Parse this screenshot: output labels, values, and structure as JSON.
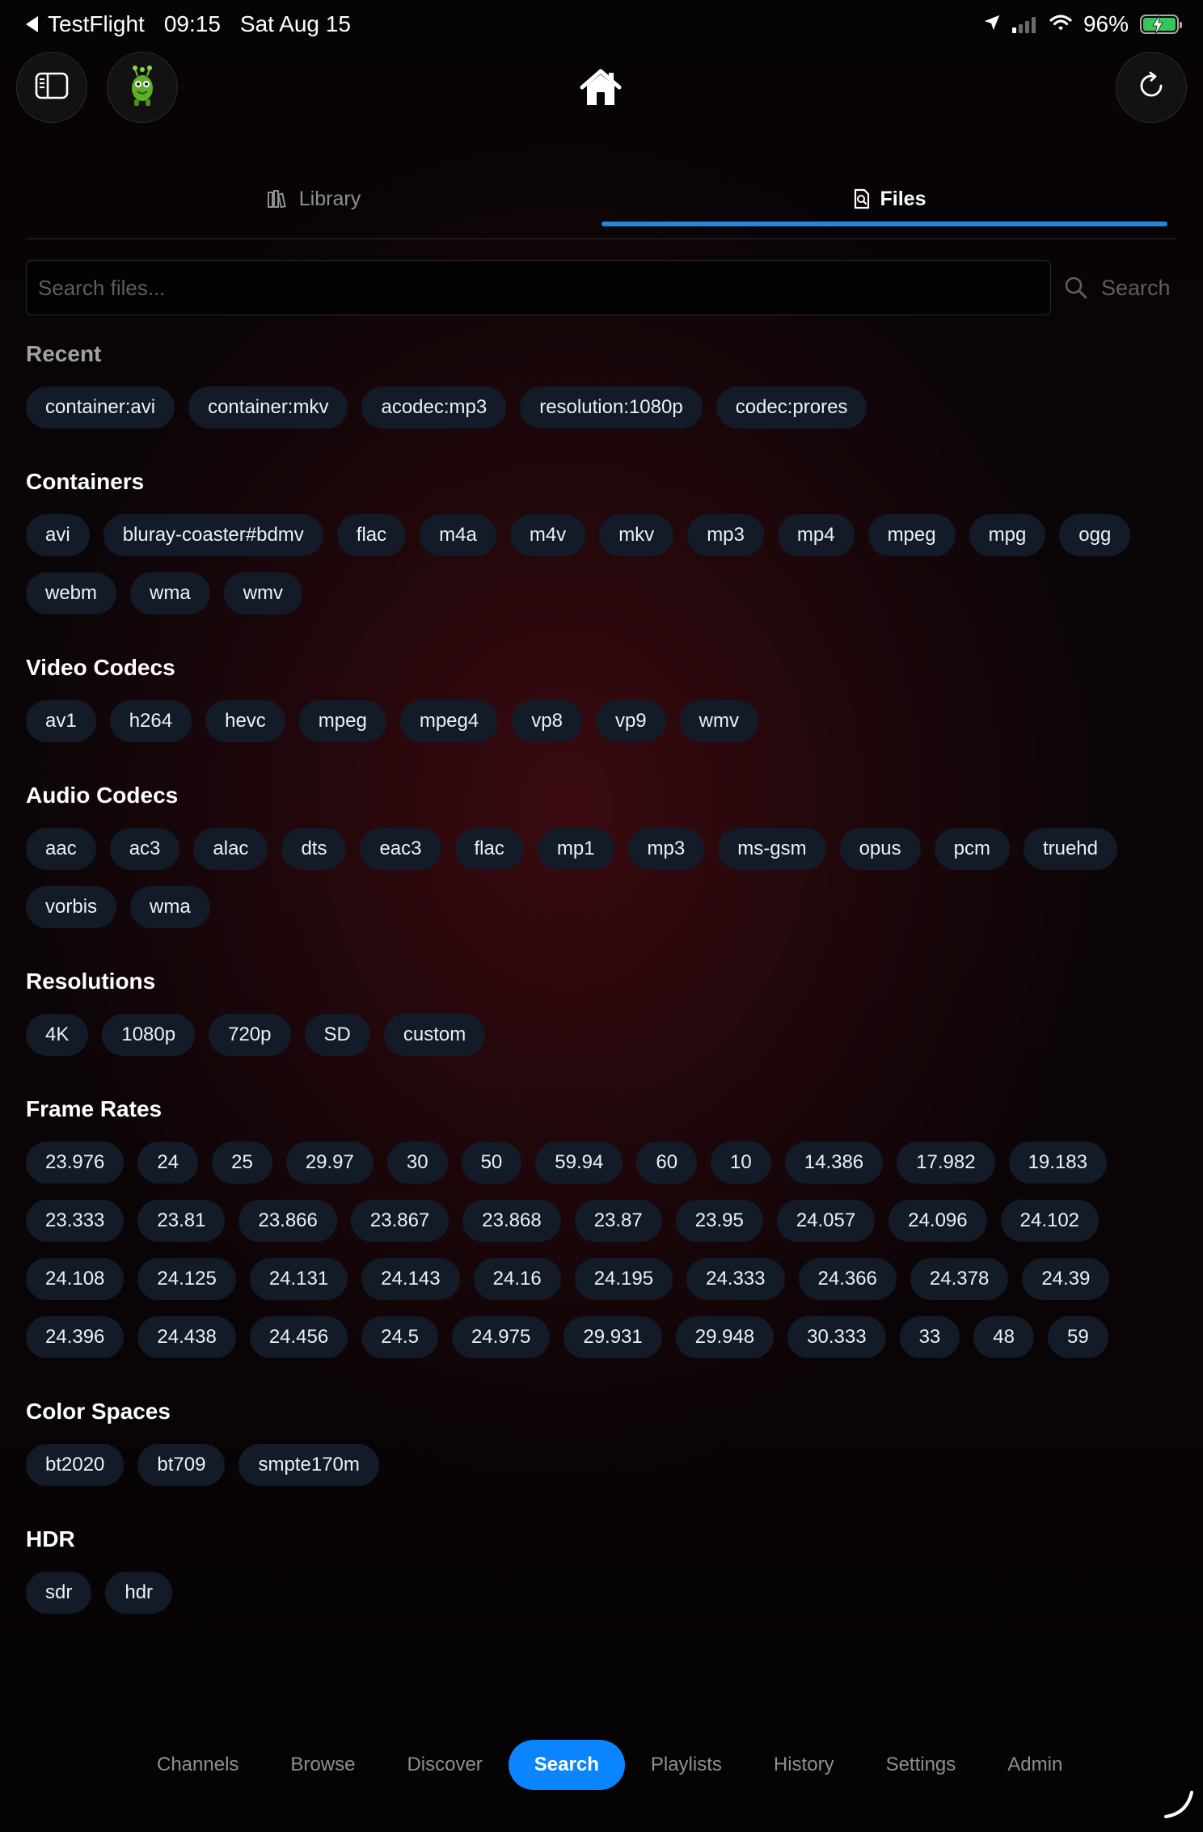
{
  "status_bar": {
    "back_app": "TestFlight",
    "time": "09:15",
    "date": "Sat Aug 15",
    "battery": "96%"
  },
  "tabs": [
    {
      "label": "Library",
      "icon": "library-icon",
      "active": false
    },
    {
      "label": "Files",
      "icon": "file-search-icon",
      "active": true
    }
  ],
  "search": {
    "placeholder": "Search files...",
    "value": "",
    "button_label": "Search"
  },
  "sections": {
    "recent": {
      "title": "Recent",
      "items": [
        "container:avi",
        "container:mkv",
        "acodec:mp3",
        "resolution:1080p",
        "codec:prores"
      ]
    },
    "containers": {
      "title": "Containers",
      "items": [
        "avi",
        "bluray-coaster#bdmv",
        "flac",
        "m4a",
        "m4v",
        "mkv",
        "mp3",
        "mp4",
        "mpeg",
        "mpg",
        "ogg",
        "webm",
        "wma",
        "wmv"
      ]
    },
    "video_codecs": {
      "title": "Video Codecs",
      "items": [
        "av1",
        "h264",
        "hevc",
        "mpeg",
        "mpeg4",
        "vp8",
        "vp9",
        "wmv"
      ]
    },
    "audio_codecs": {
      "title": "Audio Codecs",
      "items": [
        "aac",
        "ac3",
        "alac",
        "dts",
        "eac3",
        "flac",
        "mp1",
        "mp3",
        "ms-gsm",
        "opus",
        "pcm",
        "truehd",
        "vorbis",
        "wma"
      ]
    },
    "resolutions": {
      "title": "Resolutions",
      "items": [
        "4K",
        "1080p",
        "720p",
        "SD",
        "custom"
      ]
    },
    "frame_rates": {
      "title": "Frame Rates",
      "items": [
        "23.976",
        "24",
        "25",
        "29.97",
        "30",
        "50",
        "59.94",
        "60",
        "10",
        "14.386",
        "17.982",
        "19.183",
        "23.333",
        "23.81",
        "23.866",
        "23.867",
        "23.868",
        "23.87",
        "23.95",
        "24.057",
        "24.096",
        "24.102",
        "24.108",
        "24.125",
        "24.131",
        "24.143",
        "24.16",
        "24.195",
        "24.333",
        "24.366",
        "24.378",
        "24.39",
        "24.396",
        "24.438",
        "24.456",
        "24.5",
        "24.975",
        "29.931",
        "29.948",
        "30.333",
        "33",
        "48",
        "59"
      ]
    },
    "color_spaces": {
      "title": "Color Spaces",
      "items": [
        "bt2020",
        "bt709",
        "smpte170m"
      ]
    },
    "hdr": {
      "title": "HDR",
      "items": [
        "sdr",
        "hdr"
      ]
    }
  },
  "bottom_nav": {
    "items": [
      "Channels",
      "Browse",
      "Discover",
      "Search",
      "Playlists",
      "History",
      "Settings",
      "Admin"
    ],
    "active": "Search"
  },
  "colors": {
    "accent": "#0a84ff",
    "tab_underline": "#1e88e5",
    "chip_bg": "#131b28",
    "battery": "#35c759"
  }
}
